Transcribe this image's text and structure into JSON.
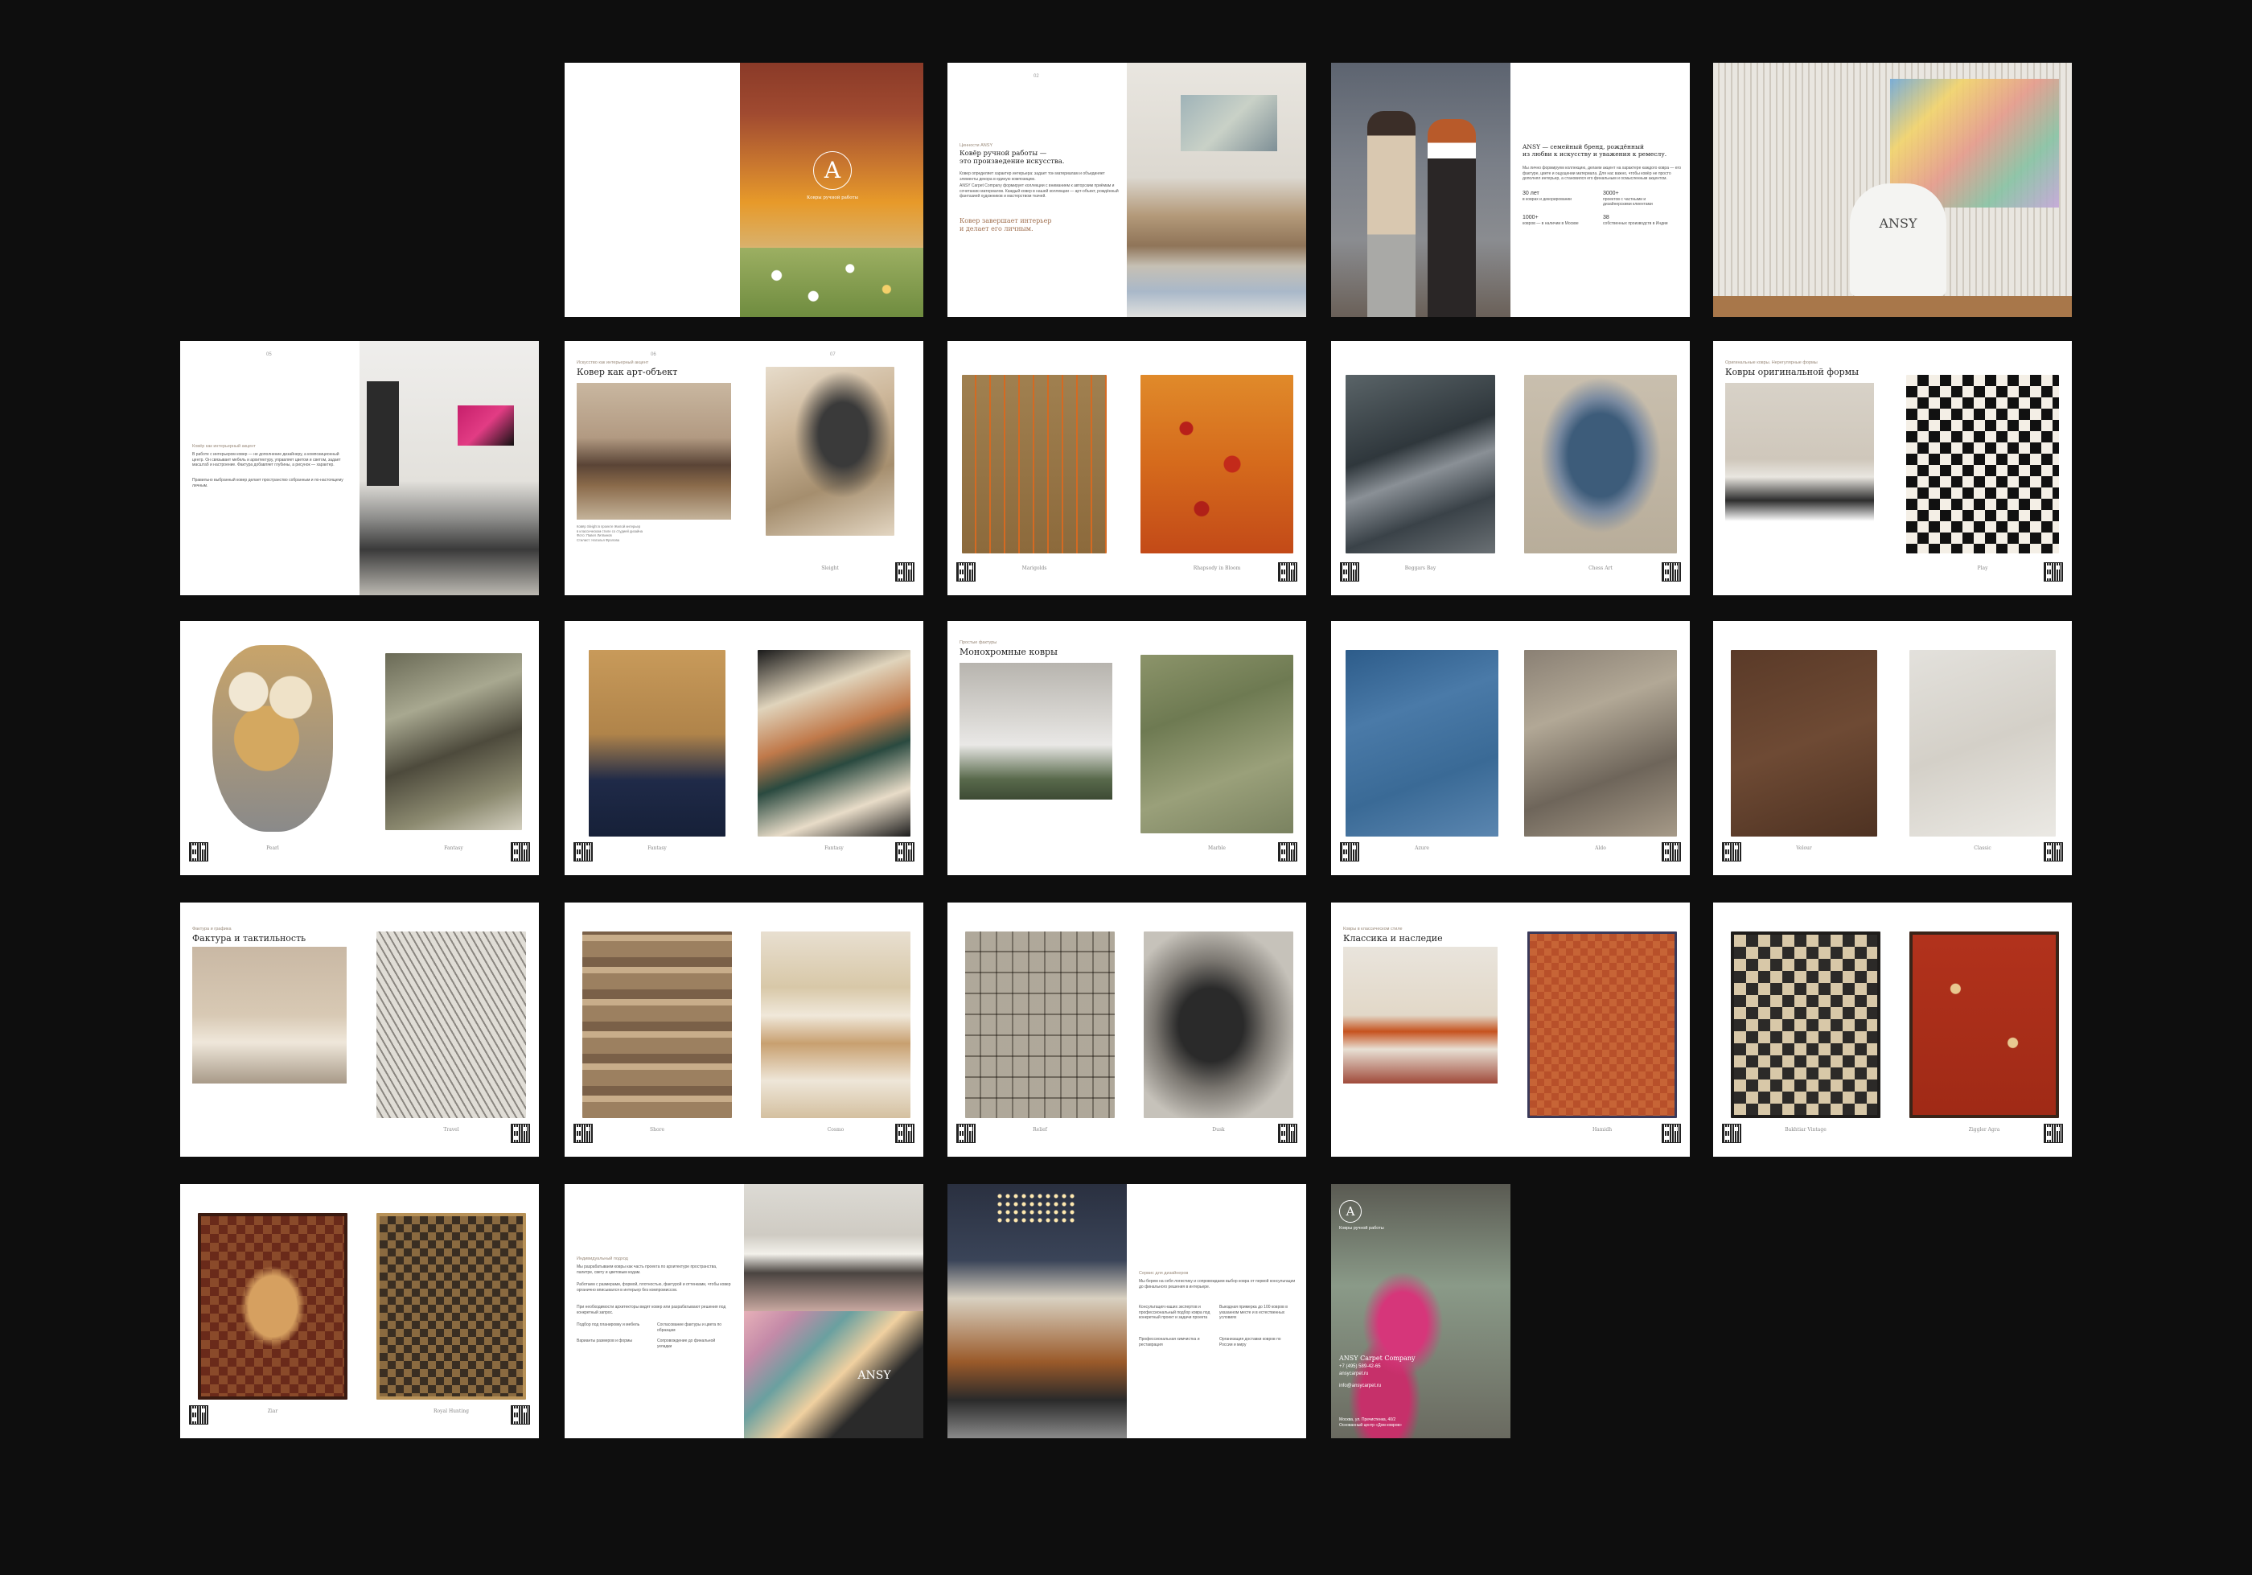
{
  "brochure": {
    "cover": {
      "logo_letter": "A",
      "tagline": "Ковры ручной работы"
    },
    "intro": {
      "page_num": "02",
      "kicker": "Ценности ANSY",
      "heading": "Ковёр ручной работы —\nэто произведение искусства.",
      "body1": "Ковер определяет характер интерьера: задает тон материалам и объединяет элементы декора в единую композицию.",
      "body2": "ANSY Carpet Company формирует коллекции с вниманием к авторским приёмам и сочетанию материалов. Каждый ковер в нашей коллекции — арт-объект, рождённый фантазией художников и мастерством ткачей.",
      "accent": "Ковер завершает интерьер\nи делает его личным."
    },
    "family": {
      "heading": "ANSY — семейный бренд, рождённый\nиз любви к искусству и уважения к ремеслу.",
      "body": "Мы лично формируем коллекцию, делаем акцент на характере каждого ковра — его фактуре, цвете и ощущении материала. Для нас важно, чтобы ковёр не просто дополнял интерьер, а становился его финальным и осмысленным акцентом.",
      "stat1_num": "30 лет",
      "stat1_txt": "в коврах и декорировании",
      "stat2_num": "3000+",
      "stat2_txt": "проектов с частными и дизайнерскими клиентами",
      "stat3_num": "1000+",
      "stat3_txt": "ковров — в наличии в Москве",
      "stat4_num": "38",
      "stat4_txt": "собственных производств в Индии"
    },
    "weaver_logo": "ANSY",
    "interior": {
      "page_num": "05",
      "kicker": "Ковёр как интерьерный акцент",
      "body1": "В работе с интерьером ковер — не дополнение дизайнеру, а композиционный центр. Он связывает мебель и архитектуру, управляет цветом и светом, задает масштаб и настроение. Фактура добавляет глубины, а рисунок — характер.",
      "body2": "Правильно выбранный ковер делает пространство собранным и по-настоящему личным."
    },
    "art_object": {
      "pages": [
        "06",
        "07"
      ],
      "kicker": "Искусство как интерьерный акцент",
      "heading": "Ковер как арт-объект",
      "caption": "Sleight",
      "credit": "Ковёр Sleight в проекте Жилой интерьер\nв классическом стиле со студией дизайна\nФото: Павел Литвинов\nСтилист: Наталья Фролова"
    },
    "rugs": {
      "marigolds": "Marigolds",
      "rhapsody": "Rhapsody in Bloom",
      "beggars": "Beggars Bay",
      "chess": "Chess Art",
      "play": "Play",
      "original_heading": "Ковры оригинальной формы",
      "original_kicker": "Оригинальные ковры. Нерегулярные формы",
      "pearl": "Pearl",
      "fantasy1": "Fantasy",
      "fantasy2": "Fantasy",
      "fantasy3": "Fantasy",
      "mono_heading": "Монохромные ковры",
      "mono_kicker": "Простые фактуры",
      "marble": "Marble",
      "azure": "Azure",
      "aldo": "Aldo",
      "velour": "Velour",
      "classic": "Classic",
      "texture_heading": "Фактура и тактильность",
      "texture_kicker": "Фактура и графика",
      "travel": "Travel",
      "shore": "Shore",
      "cosmo": "Cosmo",
      "relief": "Relief",
      "dusk": "Dusk",
      "heritage_heading": "Классика и наследие",
      "heritage_kicker": "Ковры в классическом стиле",
      "hamid": "Hamidh",
      "bakhtiar": "Bakhtiar Vintage",
      "ziggler": "Ziggler Agra",
      "ziar": "Ziar",
      "royal": "Royal Hunting"
    },
    "individual": {
      "kicker": "Индивидуальный подход",
      "body1": "Мы разрабатываем ковры как часть проекта по архитектуре пространства, палитре, свету и цветовым кодам.",
      "body2": "Работаем с размерами, формой, плотностью, фактурой и оттенками, чтобы ковер органично вписывался в интерьер без компромиссов.",
      "body3": "При необходимости архитекторы видят ковер или разрабатывают решения под конкретный запрос.",
      "item1": "Подбор под планировку и мебель",
      "item2": "Согласование фактуры и цвета по образцам",
      "item3": "Варианты размеров и формы",
      "item4": "Сопровождение до финальной укладки",
      "logo": "ANSY"
    },
    "service": {
      "kicker": "Сервис для дизайнеров",
      "body": "Мы берем на себя логистику и сопровождаем выбор ковра от первой консультации до финального решения в интерьере.",
      "col1a": "Консультация наших экспертов и профессиональный подбор ковра под конкретный проект и задачи проекта",
      "col1b": "Профессиональная химчистка и реставрация",
      "col2a": "Выездная примерка до 100 ковров в указанном месте и в естественных условиях",
      "col2b": "Организация доставки ковров по России и миру"
    },
    "back": {
      "logo_letter": "A",
      "tagline": "Ковры ручной работы",
      "company": "ANSY Carpet Company",
      "phone": "+7 (495) 589-42-65",
      "site": "ansycarpet.ru",
      "email": "info@ansycarpet.ru",
      "address": "Москва, ул. Пречистенка, 40/2\nОснованный центр «Дом ковров»"
    }
  }
}
